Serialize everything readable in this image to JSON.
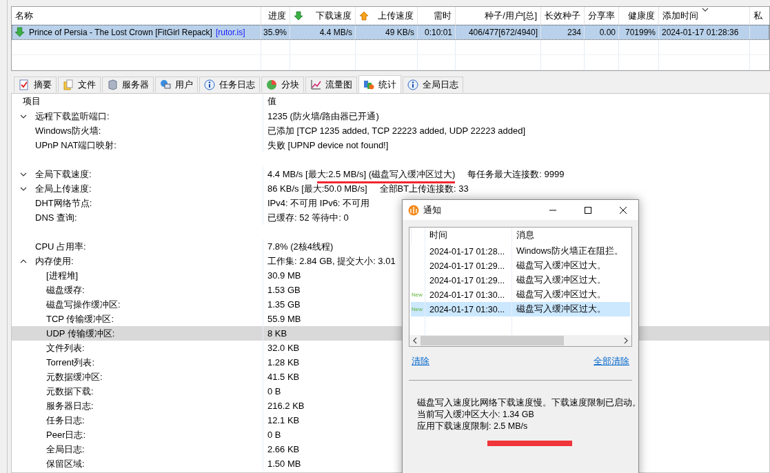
{
  "torrents": {
    "columns": [
      {
        "label": "名称"
      },
      {
        "label": "进度"
      },
      {
        "label": "下载速度"
      },
      {
        "label": "上传速度"
      },
      {
        "label": "需时"
      },
      {
        "label": "种子/用户[总]"
      },
      {
        "label": "长效种子"
      },
      {
        "label": "分享率"
      },
      {
        "label": "健康度"
      },
      {
        "label": "添加时间",
        "sorted": true
      },
      {
        "label": "私"
      }
    ],
    "rows": [
      {
        "selected": true,
        "tracker": "[rutor.is]",
        "cells": [
          "Prince of Persia - The Lost Crown [FitGirl Repack]",
          "35.9%",
          "4.4 MB/s",
          "49 KB/s",
          "0:10:01",
          "406/477[672/4940]",
          "234",
          "0.00",
          "70199%",
          "2024-01-17 01:28:36",
          ""
        ]
      }
    ]
  },
  "tabs": [
    {
      "label": "摘要",
      "selected": false
    },
    {
      "label": "文件",
      "selected": false
    },
    {
      "label": "服务器",
      "selected": false
    },
    {
      "label": "用户",
      "selected": false
    },
    {
      "label": "任务日志",
      "selected": false
    },
    {
      "label": "分块",
      "selected": false
    },
    {
      "label": "流量图",
      "selected": false
    },
    {
      "label": "统计",
      "selected": true
    },
    {
      "label": "全局日志",
      "selected": false
    }
  ],
  "stats": {
    "columns": [
      "项目",
      "值"
    ],
    "rows": [
      {
        "kind": "group",
        "expanded": false,
        "selected": false,
        "label": "远程下载监听端口:",
        "value": "1235 (防火墙/路由器已开通)"
      },
      {
        "kind": "item",
        "selected": false,
        "label": "Windows防火墙:",
        "value": "已添加 [TCP 1235 added, TCP 22223 added, UDP 22223 added]"
      },
      {
        "kind": "item",
        "selected": false,
        "label": "UPnP NAT端口映射:",
        "value": "失败 [UPNP device not found!]"
      },
      {
        "kind": "group",
        "expanded": false,
        "selected": false,
        "spaced": true,
        "label": "全局下载速度:",
        "value": "4.4 MB/s [最大:2.5 MB/s] (磁盘写入缓冲区过大)",
        "underlined": true,
        "extra": "每任务最大连接数: 9999"
      },
      {
        "kind": "group",
        "expanded": false,
        "selected": false,
        "label": "全局上传速度:",
        "value": "86 KB/s [最大:50.0 MB/s]",
        "extra": "全部BT上传连接数: 33"
      },
      {
        "kind": "item",
        "selected": false,
        "label": "DHT网络节点:",
        "value": "IPv4: 不可用  IPv6: 不可用"
      },
      {
        "kind": "item",
        "selected": false,
        "label": "DNS 查询:",
        "value": "已缓存:  52   等待中:  0"
      },
      {
        "kind": "item",
        "selected": false,
        "spaced": true,
        "label": "CPU 占用率:",
        "value": "7.8% (2核4线程)"
      },
      {
        "kind": "group",
        "expanded": true,
        "selected": false,
        "label": "内存使用:",
        "value": "工作集: 2.84 GB, 提交大小: 3.01",
        "children": [
          {
            "kind": "item",
            "selected": false,
            "label": "[进程堆]",
            "value": "30.9 MB"
          },
          {
            "kind": "item",
            "selected": false,
            "label": "磁盘缓存:",
            "value": "1.53 GB"
          },
          {
            "kind": "item",
            "selected": false,
            "label": "磁盘写操作缓冲区:",
            "value": "1.35 GB"
          },
          {
            "kind": "item",
            "selected": false,
            "label": "TCP 传输缓冲区:",
            "value": "55.9 MB"
          },
          {
            "kind": "item",
            "selected": true,
            "label": "UDP 传输缓冲区:",
            "value": "8 KB"
          },
          {
            "kind": "item",
            "selected": false,
            "label": "文件列表:",
            "value": "32.0 KB"
          },
          {
            "kind": "item",
            "selected": false,
            "label": "Torrent列表:",
            "value": "1.28 KB"
          },
          {
            "kind": "item",
            "selected": false,
            "label": "元数据缓冲区:",
            "value": "41.5 KB"
          },
          {
            "kind": "item",
            "selected": false,
            "label": "元数据下载:",
            "value": "0 B"
          },
          {
            "kind": "item",
            "selected": false,
            "label": "服务器日志:",
            "value": "216.2 KB"
          },
          {
            "kind": "item",
            "selected": false,
            "label": "任务日志:",
            "value": "12.1 KB"
          },
          {
            "kind": "item",
            "selected": false,
            "label": "Peer日志:",
            "value": "0 B"
          },
          {
            "kind": "item",
            "selected": false,
            "label": "全局日志:",
            "value": "2.66 KB"
          },
          {
            "kind": "item",
            "selected": false,
            "label": "保留区域:",
            "value": "1.50 MB"
          }
        ]
      }
    ]
  },
  "dialog": {
    "title": "通知",
    "columns": [
      "时间",
      "消息"
    ],
    "rows": [
      {
        "time": "2024-01-17 01:28...",
        "message": "Windows防火墙正在阻拦。",
        "selected": false
      },
      {
        "time": "2024-01-17 01:29...",
        "message": "磁盘写入缓冲区过大。",
        "selected": false
      },
      {
        "time": "2024-01-17 01:29...",
        "message": "磁盘写入缓冲区过大。",
        "selected": false
      },
      {
        "badge": "New",
        "time": "2024-01-17 01:30...",
        "message": "磁盘写入缓冲区过大。",
        "selected": false
      },
      {
        "badge": "New",
        "time": "2024-01-17 01:30...",
        "message": "磁盘写入缓冲区过大。",
        "selected": true
      }
    ],
    "links": [
      "清除",
      "全部清除"
    ],
    "messages": [
      {
        "text": "磁盘写入速度比网络下载速度慢。下载速度限制已启动。",
        "marked": false
      },
      {
        "text": "当前写入缓冲区大小:  1.34 GB",
        "marked": false
      },
      {
        "text": "应用下载速度限制:  2.5 MB/s",
        "marked": true
      }
    ]
  }
}
